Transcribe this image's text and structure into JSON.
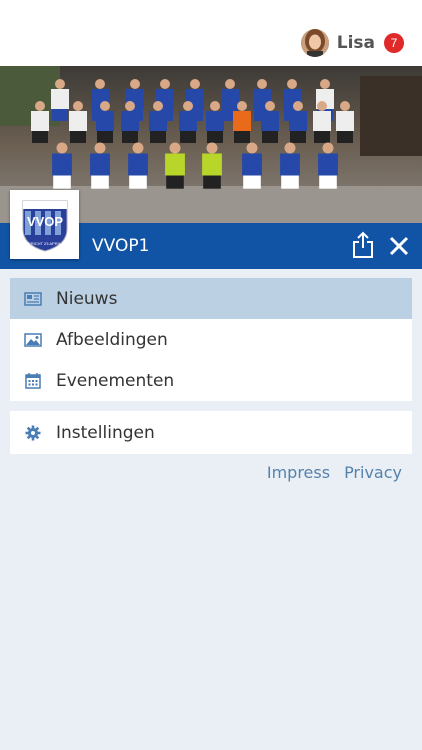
{
  "header": {
    "user_name": "Lisa",
    "notification_count": "7"
  },
  "club": {
    "name": "VVOP1",
    "logo_text": "VVOP",
    "logo_subtext": "OPGERICHT 23 APRIL 1928"
  },
  "menu": {
    "items": [
      {
        "label": "Nieuws",
        "icon": "newspaper-icon",
        "active": true
      },
      {
        "label": "Afbeeldingen",
        "icon": "image-icon",
        "active": false
      },
      {
        "label": "Evenementen",
        "icon": "calendar-icon",
        "active": false
      }
    ],
    "settings": {
      "label": "Instellingen",
      "icon": "gear-icon"
    }
  },
  "footer": {
    "impress_label": "Impress",
    "privacy_label": "Privacy"
  },
  "colors": {
    "brand_blue": "#1154a6",
    "active_row": "#bcd0e4",
    "link": "#5582ad",
    "badge": "#e02a2a"
  }
}
